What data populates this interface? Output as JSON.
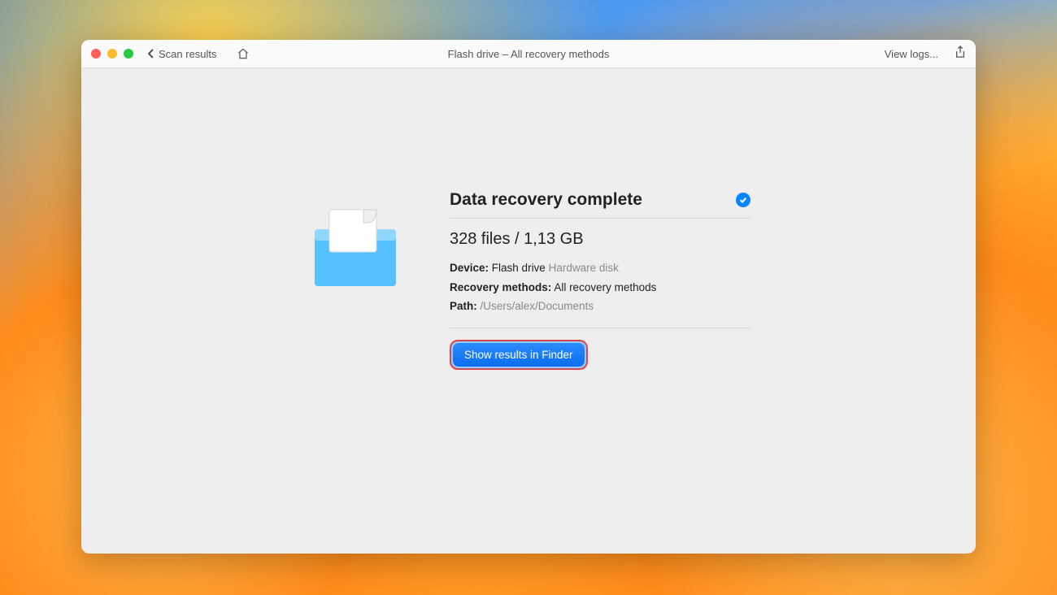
{
  "toolbar": {
    "back_label": "Scan results",
    "view_logs_label": "View logs...",
    "window_title": "Flash drive – All recovery methods"
  },
  "result": {
    "heading": "Data recovery complete",
    "stats": "328 files / 1,13 GB",
    "device_label": "Device:",
    "device_value": "Flash drive",
    "device_note": "Hardware disk",
    "methods_label": "Recovery methods:",
    "methods_value": "All recovery methods",
    "path_label": "Path:",
    "path_value": "/Users/alex/Documents",
    "button_label": "Show results in Finder"
  }
}
